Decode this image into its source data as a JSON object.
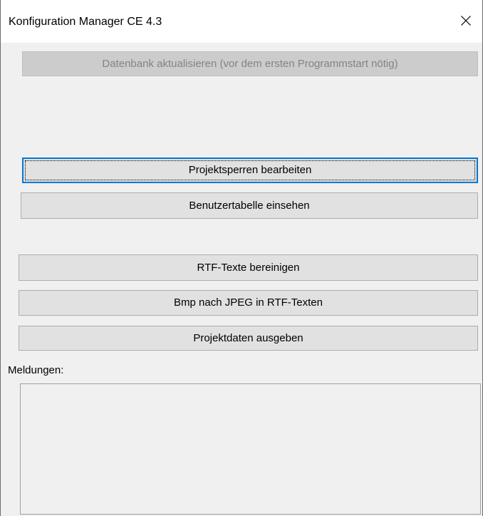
{
  "window": {
    "title": "Konfiguration Manager CE 4.3",
    "close_symbol": "✕"
  },
  "buttons": {
    "update_db": "Datenbank aktualisieren (vor dem ersten Programmstart nötig)",
    "project_locks": "Projektsperren bearbeiten",
    "user_table": "Benutzertabelle einsehen",
    "rtf_clean": "RTF-Texte bereinigen",
    "bmp_to_jpeg": "Bmp nach JPEG in RTF-Texten",
    "export_project": "Projektdaten ausgeben"
  },
  "messages": {
    "label": "Meldungen:",
    "content": ""
  },
  "colors": {
    "window_bg": "#f0f0f0",
    "titlebar_bg": "#ffffff",
    "button_bg": "#e1e1e1",
    "button_border": "#adadad",
    "focus_accent": "#0078d7",
    "disabled_text": "#838383"
  },
  "icons": {
    "close": "close-icon"
  },
  "state": {
    "update_db_enabled": false,
    "focused_button": "project_locks"
  }
}
